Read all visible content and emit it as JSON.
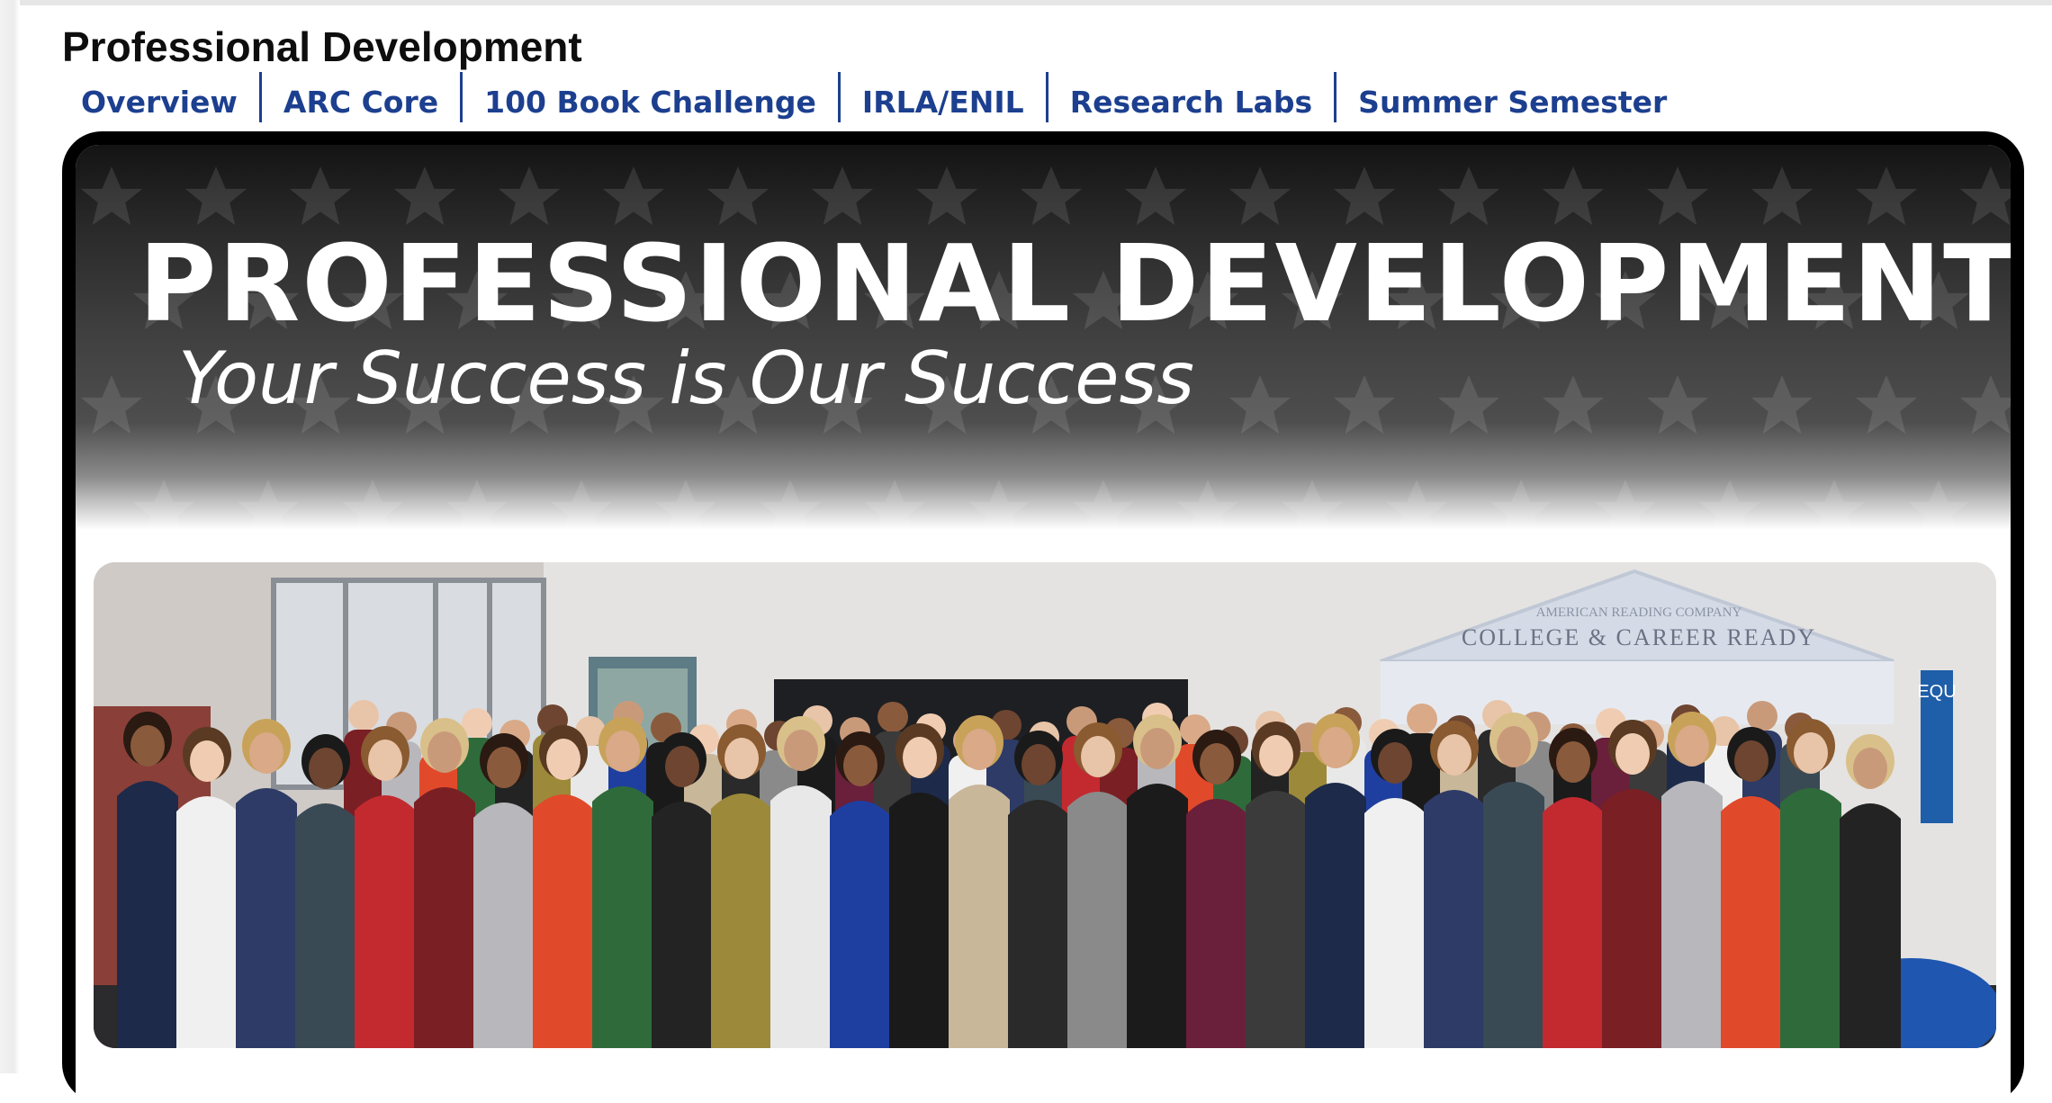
{
  "page": {
    "title": "Professional Development"
  },
  "nav": {
    "items": [
      {
        "label": "Overview"
      },
      {
        "label": "ARC Core"
      },
      {
        "label": "100 Book Challenge"
      },
      {
        "label": "IRLA/ENIL"
      },
      {
        "label": "Research Labs"
      },
      {
        "label": "Summer Semester"
      }
    ],
    "link_color": "#1c3f8f"
  },
  "banner": {
    "title": "PROFESSIONAL DEVELOPMENT",
    "subtitle": "Your Success is Our Success",
    "pattern_icon": "star-icon"
  },
  "photo": {
    "backdrop_line1": "AMERICAN READING COMPANY",
    "backdrop_line2": "COLLEGE & CAREER READY",
    "side_letters": "EQU"
  },
  "colors": {
    "frame": "#000000",
    "title_text": "#0e0e0e",
    "banner_text": "#ffffff"
  }
}
